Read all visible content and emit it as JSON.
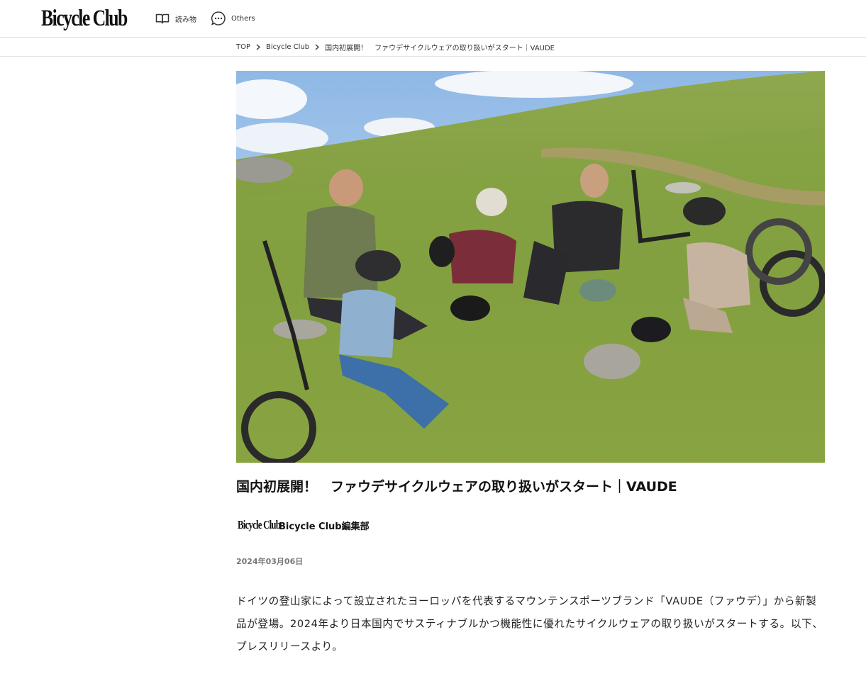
{
  "header": {
    "logo": "Bicycle Club",
    "nav": [
      {
        "label": "読み物",
        "icon": "book-icon"
      },
      {
        "label": "Others",
        "icon": "chat-bubble-icon"
      }
    ]
  },
  "breadcrumb": {
    "items": [
      "TOP",
      "Bicycle Club",
      "国内初展開！　ファウデサイクルウェアの取り扱いがスタート｜VAUDE"
    ]
  },
  "article": {
    "hero_image": "group-of-mountain-bikers-resting-on-grassy-hillside",
    "title": "国内初展開！　ファウデサイクルウェアの取り扱いがスタート｜VAUDE",
    "author": {
      "logo": "Bicycle Club",
      "name": "Bicycle Club編集部"
    },
    "date": "2024年03月06日",
    "lead": "ドイツの登山家によって設立されたヨーロッパを代表するマウンテンスポーツブランド「VAUDE（ファウデ）」から新製品が登場。2024年より日本国内でサスティナブルかつ機能性に優れたサイクルウェアの取り扱いがスタートする。以下、プレスリリースより。"
  },
  "colors": {
    "header_border": "#dddddd",
    "date_text": "#777777",
    "sky": "#a9c9e8",
    "grass": "#7a9a3a"
  }
}
